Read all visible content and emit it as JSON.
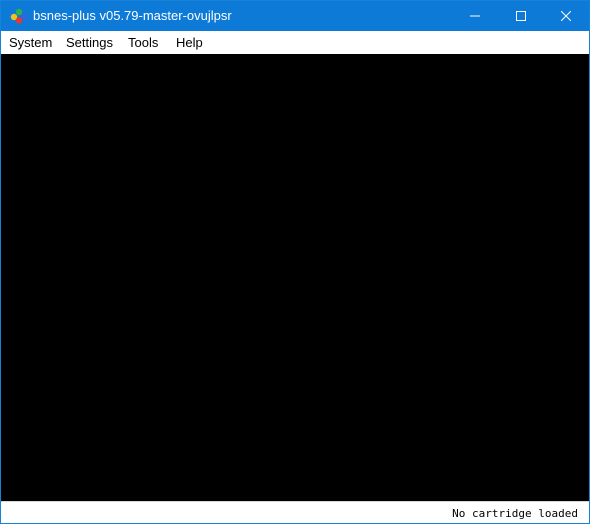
{
  "window": {
    "title": "bsnes-plus v05.79-master-ovujlpsr",
    "app_icon": "bsnes-logo-icon",
    "controls": {
      "minimize": "minimize-icon",
      "maximize": "maximize-icon",
      "close": "close-icon"
    }
  },
  "menubar": {
    "items": [
      {
        "label": "System"
      },
      {
        "label": "Settings"
      },
      {
        "label": "Tools"
      },
      {
        "label": "Help"
      }
    ]
  },
  "statusbar": {
    "text": "No cartridge loaded"
  },
  "colors": {
    "titlebar": "#0c7ad6",
    "viewport": "#000000",
    "menubar": "#ffffff"
  }
}
